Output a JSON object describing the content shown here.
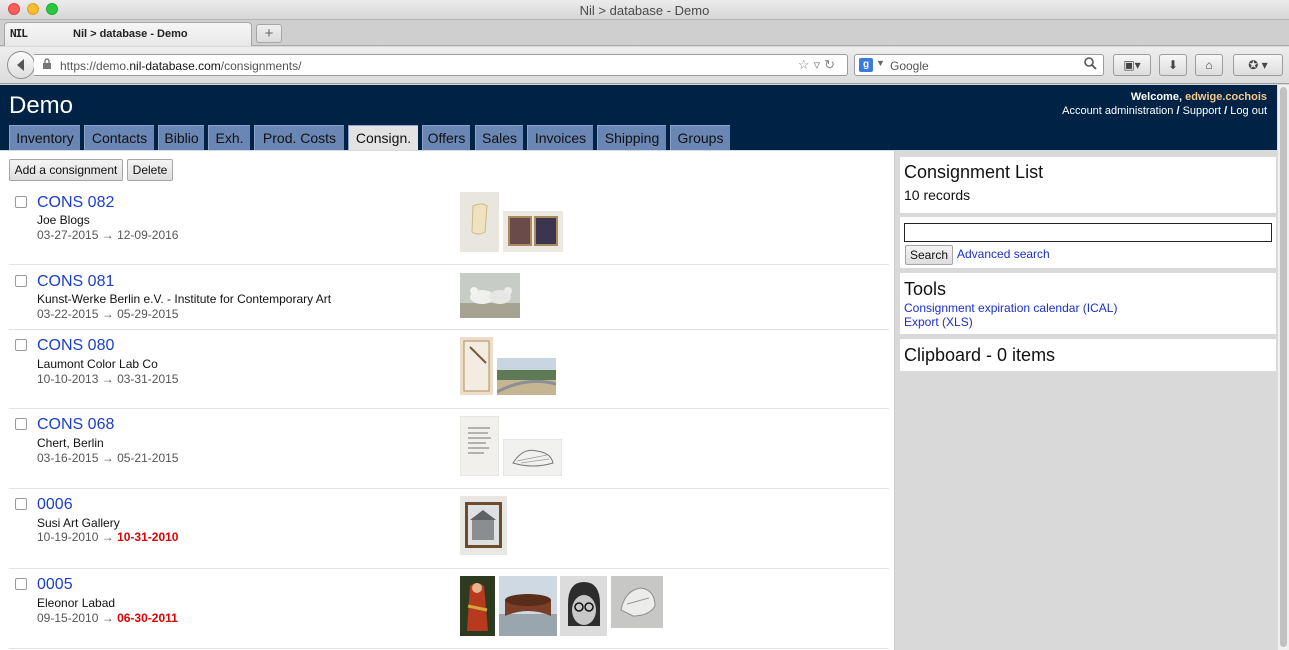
{
  "window": {
    "title": "Nil > database - Demo"
  },
  "browser": {
    "tab_favicon": "NIL",
    "tab_title": "Nil > database - Demo",
    "new_tab": "+",
    "url_prefix": "https://demo.",
    "url_domain": "nil-database.com",
    "url_path": "/consignments/",
    "search_engine": "g",
    "search_placeholder": "Google"
  },
  "app": {
    "brand": "Demo",
    "welcome_label": "Welcome,",
    "username": "edwige.cochois",
    "account_link": "Account administration",
    "support_link": "Support",
    "logout_link": "Log out",
    "separator": "/"
  },
  "nav": [
    "Inventory",
    "Contacts",
    "Biblio",
    "Exh.",
    "Prod. Costs",
    "Consign.",
    "Offers",
    "Sales",
    "Invoices",
    "Shipping",
    "Groups"
  ],
  "nav_active": "Consign.",
  "toolbar": {
    "add_label": "Add a consignment",
    "delete_label": "Delete"
  },
  "consignments": [
    {
      "id": "CONS 082",
      "contact": "Joe Blogs",
      "start": "03-27-2015",
      "end": "12-09-2016",
      "expired": false
    },
    {
      "id": "CONS 081",
      "contact": "Kunst-Werke Berlin e.V. - Institute for Contemporary Art",
      "start": "03-22-2015",
      "end": "05-29-2015",
      "expired": false
    },
    {
      "id": "CONS 080",
      "contact": "Laumont Color Lab Co",
      "start": "10-10-2013",
      "end": "03-31-2015",
      "expired": false
    },
    {
      "id": "CONS 068",
      "contact": "Chert, Berlin",
      "start": "03-16-2015",
      "end": "05-21-2015",
      "expired": false
    },
    {
      "id": "0006",
      "contact": "Susi Art Gallery",
      "start": "10-19-2010",
      "end": "10-31-2010",
      "expired": true
    },
    {
      "id": "0005",
      "contact": "Eleonor Labad",
      "start": "09-15-2010",
      "end": "06-30-2011",
      "expired": true
    }
  ],
  "arrow": "→",
  "sidebar": {
    "list_title": "Consignment List",
    "records": "10 records",
    "search_button": "Search",
    "advanced_search": "Advanced search",
    "tools_title": "Tools",
    "tool_ical": "Consignment expiration calendar (ICAL)",
    "tool_xls": "Export (XLS)",
    "clipboard_title": "Clipboard - 0 items"
  },
  "colors": {
    "header_bg": "#002244",
    "tab_bg": "#6a86b4",
    "link": "#1a3fcc",
    "expired": "#e00000",
    "username": "#f6c88a"
  }
}
